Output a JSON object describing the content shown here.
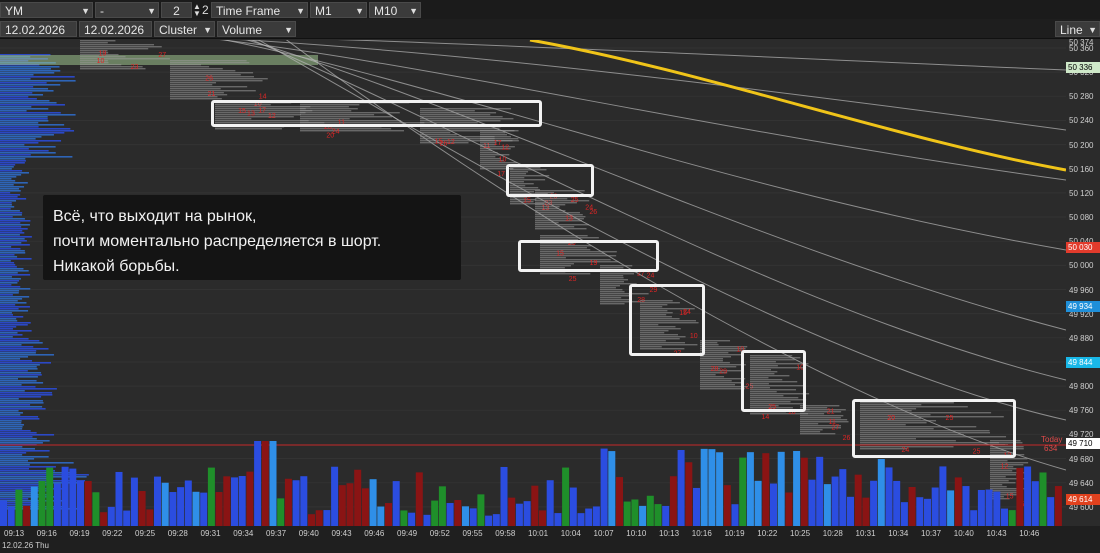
{
  "toolbar": {
    "symbol": "YM",
    "dash": "-",
    "number_value": "2",
    "number_suffix": "2",
    "timeframe_label": "Time Frame",
    "m1": "M1",
    "m10": "M10",
    "date_from": "12.02.2026",
    "date_to": "12.02.2026",
    "cluster": "Cluster",
    "volume": "Volume",
    "line": "Line"
  },
  "price_axis": {
    "ticks": [
      "50 360",
      "50 320",
      "50 280",
      "50 240",
      "50 200",
      "50 160",
      "50 120",
      "50 080",
      "50 040",
      "50 000",
      "49 960",
      "49 920",
      "49 880",
      "49 840",
      "49 800",
      "49 760",
      "49 720",
      "49 680",
      "49 640",
      "49 600"
    ],
    "top_partial": "50 374",
    "badges": [
      {
        "text": "50 336",
        "color": "#cfe9c9",
        "fg": "#000000"
      },
      {
        "text": "50 030",
        "color": "#e23b2c",
        "fg": "#ffffff"
      },
      {
        "text": "49 934",
        "color": "#1f8fd9",
        "fg": "#ffffff"
      },
      {
        "text": "49 844",
        "color": "#19b8e8",
        "fg": "#ffffff"
      },
      {
        "text": "49 710",
        "color": "#ffffff",
        "fg": "#000000"
      },
      {
        "text": "49 614",
        "color": "#e0411e",
        "fg": "#ffffff"
      }
    ]
  },
  "time_axis": {
    "ticks": [
      "09:13",
      "09:16",
      "09:19",
      "09:22",
      "09:25",
      "09:28",
      "09:31",
      "09:34",
      "09:37",
      "09:40",
      "09:43",
      "09:46",
      "09:49",
      "09:52",
      "09:55",
      "09:58",
      "10:01",
      "10:04",
      "10:07",
      "10:10",
      "10:13",
      "10:16",
      "10:19",
      "10:22",
      "10:25",
      "10:28",
      "10:31",
      "10:34",
      "10:37",
      "10:40",
      "10:43",
      "10:46"
    ],
    "date": "12.02.26 Thu"
  },
  "annotation": {
    "line1": "Всё, что выходит на рынок,",
    "line2": "почти моментально распределяется в шорт.",
    "line3": "Никакой борьбы."
  },
  "markers": {
    "today": "Today",
    "today_value": "634"
  },
  "colors": {
    "background": "#2b2b2b",
    "ma_line": "#f0c419",
    "bar_blue": "#2b4de0",
    "bar_red": "#8a1414",
    "bar_green": "#1f8f2a",
    "bar_light_blue": "#2f8fe8",
    "level_line": "#c62828"
  }
}
